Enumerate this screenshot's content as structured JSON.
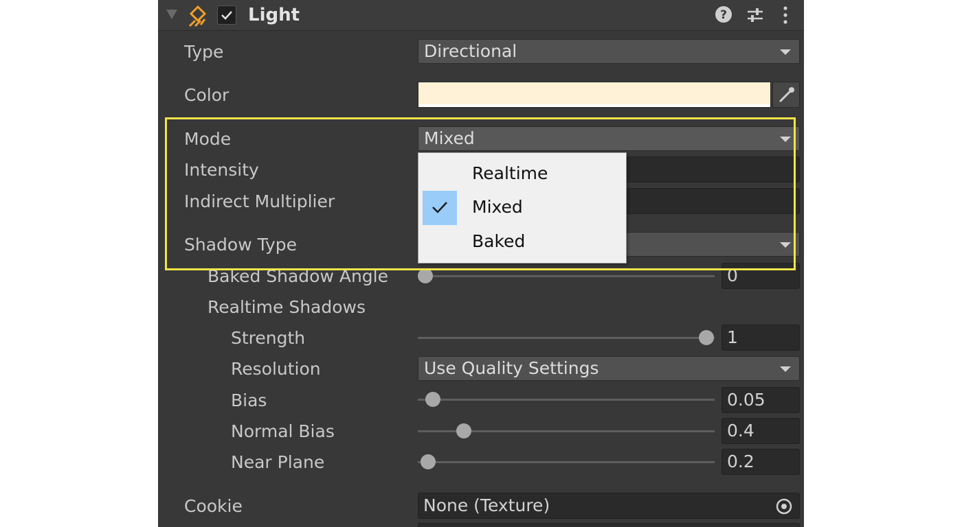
{
  "header": {
    "title": "Light",
    "enabled": true,
    "icons": {
      "component": "light-icon",
      "help": "help-icon",
      "presets": "sliders-icon",
      "menu": "kebab-menu-icon"
    }
  },
  "fields": {
    "type": {
      "label": "Type",
      "value": "Directional"
    },
    "color": {
      "label": "Color",
      "swatch": "#fff2d6",
      "picker_icon": "eyedropper-icon"
    },
    "mode": {
      "label": "Mode",
      "value": "Mixed"
    },
    "intensity": {
      "label": "Intensity"
    },
    "indirect_multiplier": {
      "label": "Indirect Multiplier"
    },
    "shadow_type": {
      "label": "Shadow Type"
    },
    "baked_shadow_angle": {
      "label": "Baked Shadow Angle",
      "value": "0",
      "fraction": 0.0
    },
    "realtime_shadows": {
      "label": "Realtime Shadows"
    },
    "strength": {
      "label": "Strength",
      "value": "1",
      "fraction": 1.0
    },
    "resolution": {
      "label": "Resolution",
      "value": "Use Quality Settings"
    },
    "bias": {
      "label": "Bias",
      "value": "0.05",
      "fraction": 0.05
    },
    "normal_bias": {
      "label": "Normal Bias",
      "value": "0.4",
      "fraction": 0.13
    },
    "near_plane": {
      "label": "Near Plane",
      "value": "0.2",
      "fraction": 0.02
    },
    "cookie": {
      "label": "Cookie",
      "value": "None (Texture)",
      "picker_icon": "object-picker-icon"
    }
  },
  "mode_menu": {
    "options": [
      {
        "label": "Realtime",
        "selected": false
      },
      {
        "label": "Mixed",
        "selected": true
      },
      {
        "label": "Baked",
        "selected": false
      }
    ],
    "check_color": "#99ccf8"
  },
  "colors": {
    "panel": "#383838",
    "highlight_border": "#f2e44a",
    "light_icon": "#f0a028"
  }
}
